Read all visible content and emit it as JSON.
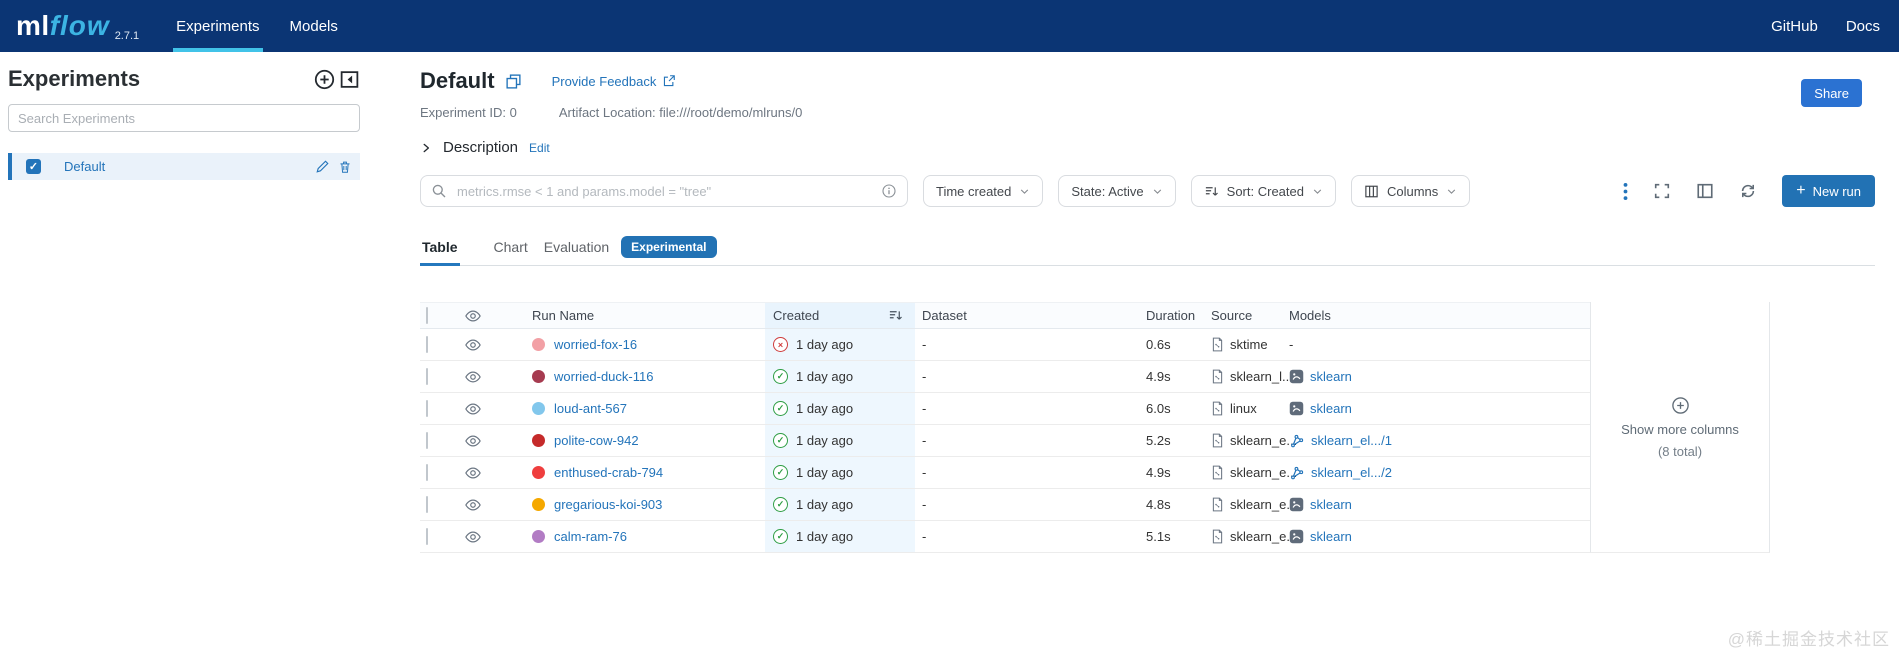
{
  "navbar": {
    "logo": {
      "ml": "ml",
      "flow": "flow",
      "version": "2.7.1"
    },
    "tabs": [
      {
        "label": "Experiments",
        "active": true
      },
      {
        "label": "Models",
        "active": false
      }
    ],
    "links": [
      {
        "label": "GitHub"
      },
      {
        "label": "Docs"
      }
    ]
  },
  "sidebar": {
    "title": "Experiments",
    "search_placeholder": "Search Experiments",
    "selected_item": {
      "label": "Default",
      "selected": true
    }
  },
  "header": {
    "title": "Default",
    "feedback_link": "Provide Feedback",
    "experiment_id": "Experiment ID: 0",
    "artifact_location": "Artifact Location: file:///root/demo/mlruns/0",
    "share_button": "Share"
  },
  "description_section": {
    "label": "Description",
    "edit_link": "Edit"
  },
  "controls": {
    "search_placeholder": "metrics.rmse < 1 and params.model = \"tree\"",
    "time_created_filter": "Time created",
    "state_filter": "State: Active",
    "sort_filter": "Sort: Created",
    "columns_button": "Columns",
    "new_run_plus": "+",
    "new_run_button": "New run"
  },
  "view_tabs": {
    "table": "Table",
    "chart": "Chart",
    "evaluation": "Evaluation",
    "experimental_badge": "Experimental"
  },
  "table": {
    "headers": {
      "run_name": "Run Name",
      "created": "Created",
      "dataset": "Dataset",
      "duration": "Duration",
      "source": "Source",
      "models": "Models"
    },
    "rows": [
      {
        "run_name": "worried-fox-16",
        "dot_color": "#f2a0a5",
        "status": "failed",
        "created": "1 day ago",
        "dataset": "-",
        "duration": "0.6s",
        "source": "sktime",
        "model": "-",
        "model_registered": false
      },
      {
        "run_name": "worried-duck-116",
        "dot_color": "#a63b50",
        "status": "finished",
        "created": "1 day ago",
        "dataset": "-",
        "duration": "4.9s",
        "source": "sklearn_l...",
        "model": "sklearn",
        "model_registered": false
      },
      {
        "run_name": "loud-ant-567",
        "dot_color": "#82c7ec",
        "status": "finished",
        "created": "1 day ago",
        "dataset": "-",
        "duration": "6.0s",
        "source": "linux",
        "model": "sklearn",
        "model_registered": false
      },
      {
        "run_name": "polite-cow-942",
        "dot_color": "#c52a2a",
        "status": "finished",
        "created": "1 day ago",
        "dataset": "-",
        "duration": "5.2s",
        "source": "sklearn_e...",
        "model": "sklearn_el.../1",
        "model_registered": true
      },
      {
        "run_name": "enthused-crab-794",
        "dot_color": "#ef3e3e",
        "status": "finished",
        "created": "1 day ago",
        "dataset": "-",
        "duration": "4.9s",
        "source": "sklearn_e...",
        "model": "sklearn_el.../2",
        "model_registered": true
      },
      {
        "run_name": "gregarious-koi-903",
        "dot_color": "#f5a800",
        "status": "finished",
        "created": "1 day ago",
        "dataset": "-",
        "duration": "4.8s",
        "source": "sklearn_e...",
        "model": "sklearn",
        "model_registered": false
      },
      {
        "run_name": "calm-ram-76",
        "dot_color": "#b27cc4",
        "status": "finished",
        "created": "1 day ago",
        "dataset": "-",
        "duration": "5.1s",
        "source": "sklearn_e...",
        "model": "sklearn",
        "model_registered": false
      }
    ],
    "show_more_columns": {
      "line1": "Show more columns",
      "line2": "(8 total)"
    }
  },
  "icons": {
    "check": "✓",
    "status_glyphs": {
      "finished": "✓",
      "failed": "×"
    },
    "dash": "-"
  },
  "watermark": "@稀土掘金技术社区",
  "colors": {
    "navbar_bg": "#0b3574",
    "accent_blue": "#2374ba",
    "logo_flow": "#3cb4e3",
    "nav_active_underline": "#41c3e8",
    "primary_button": "#2272b4",
    "share_button": "#2b72d2",
    "success_green": "#2f9e44",
    "failed_red": "#cf3c3c",
    "created_column_bg": "#eef7fe"
  }
}
